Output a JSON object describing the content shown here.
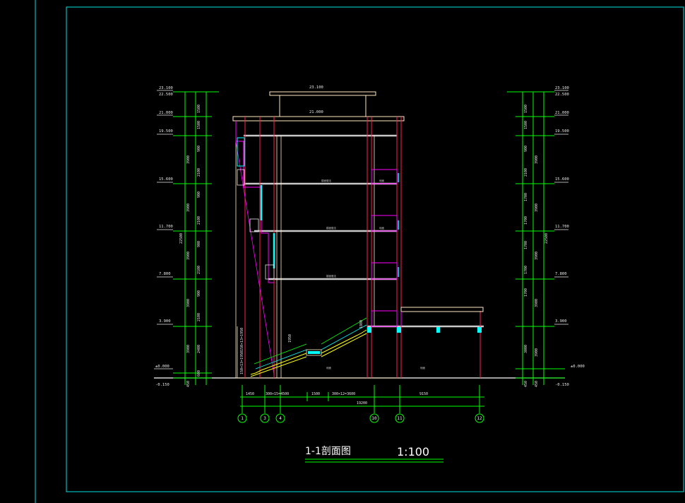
{
  "drawing": {
    "title": "1-1剖面图",
    "scale": "1:100"
  },
  "elevations_left": [
    "23.100",
    "22.500",
    "21.000",
    "19.500",
    "15.600",
    "11.700",
    "7.800",
    "3.900",
    "±0.000",
    "-0.150"
  ],
  "elevations_right": [
    "23.100",
    "22.500",
    "21.000",
    "19.500",
    "15.600",
    "11.700",
    "7.800",
    "3.900",
    "±0.000",
    "-0.150"
  ],
  "elevation_top": "23.100",
  "elevation_roof": "21.000",
  "dims_left_inner": [
    "600",
    "1500",
    "1500",
    "900",
    "2100",
    "900",
    "2100",
    "900",
    "2100",
    "900",
    "2100",
    "900",
    "2400",
    "600"
  ],
  "dims_left_outer": [
    "3900",
    "3900",
    "3900",
    "3900",
    "3900",
    "450"
  ],
  "total_height": "22500",
  "dims_right_inner": [
    "600",
    "1500",
    "1500",
    "900",
    "2100",
    "1700",
    "1700",
    "1700",
    "1700",
    "1700",
    "3000",
    "450"
  ],
  "dims_right_outer": [
    "3900",
    "3900",
    "3900",
    "3900",
    "3900",
    "450"
  ],
  "bottom_dims": [
    "1450",
    "300×15=4500",
    "1500",
    "300×12=3600",
    "9150"
  ],
  "bottom_total": "19200",
  "axes": [
    "1",
    "3",
    "4",
    "10",
    "11",
    "12"
  ],
  "stair_notes": [
    "150×13=1950",
    "150×13=1950",
    "1950",
    "1800"
  ],
  "floor_labels": [
    "楼面做法",
    "楼面做法",
    "楼面做法"
  ],
  "room_labels": [
    "地面",
    "地面",
    "地面",
    "地面"
  ],
  "colors": {
    "frame": "#00e0e0",
    "axis": "#00ff00",
    "wall": "#ff2050",
    "slab": "#c8c8c8",
    "outline": "#ffe8c0",
    "accent": "#ff00ff",
    "glass": "#00ffff",
    "stair": "#ffff00",
    "text": "#e8e8e8"
  }
}
